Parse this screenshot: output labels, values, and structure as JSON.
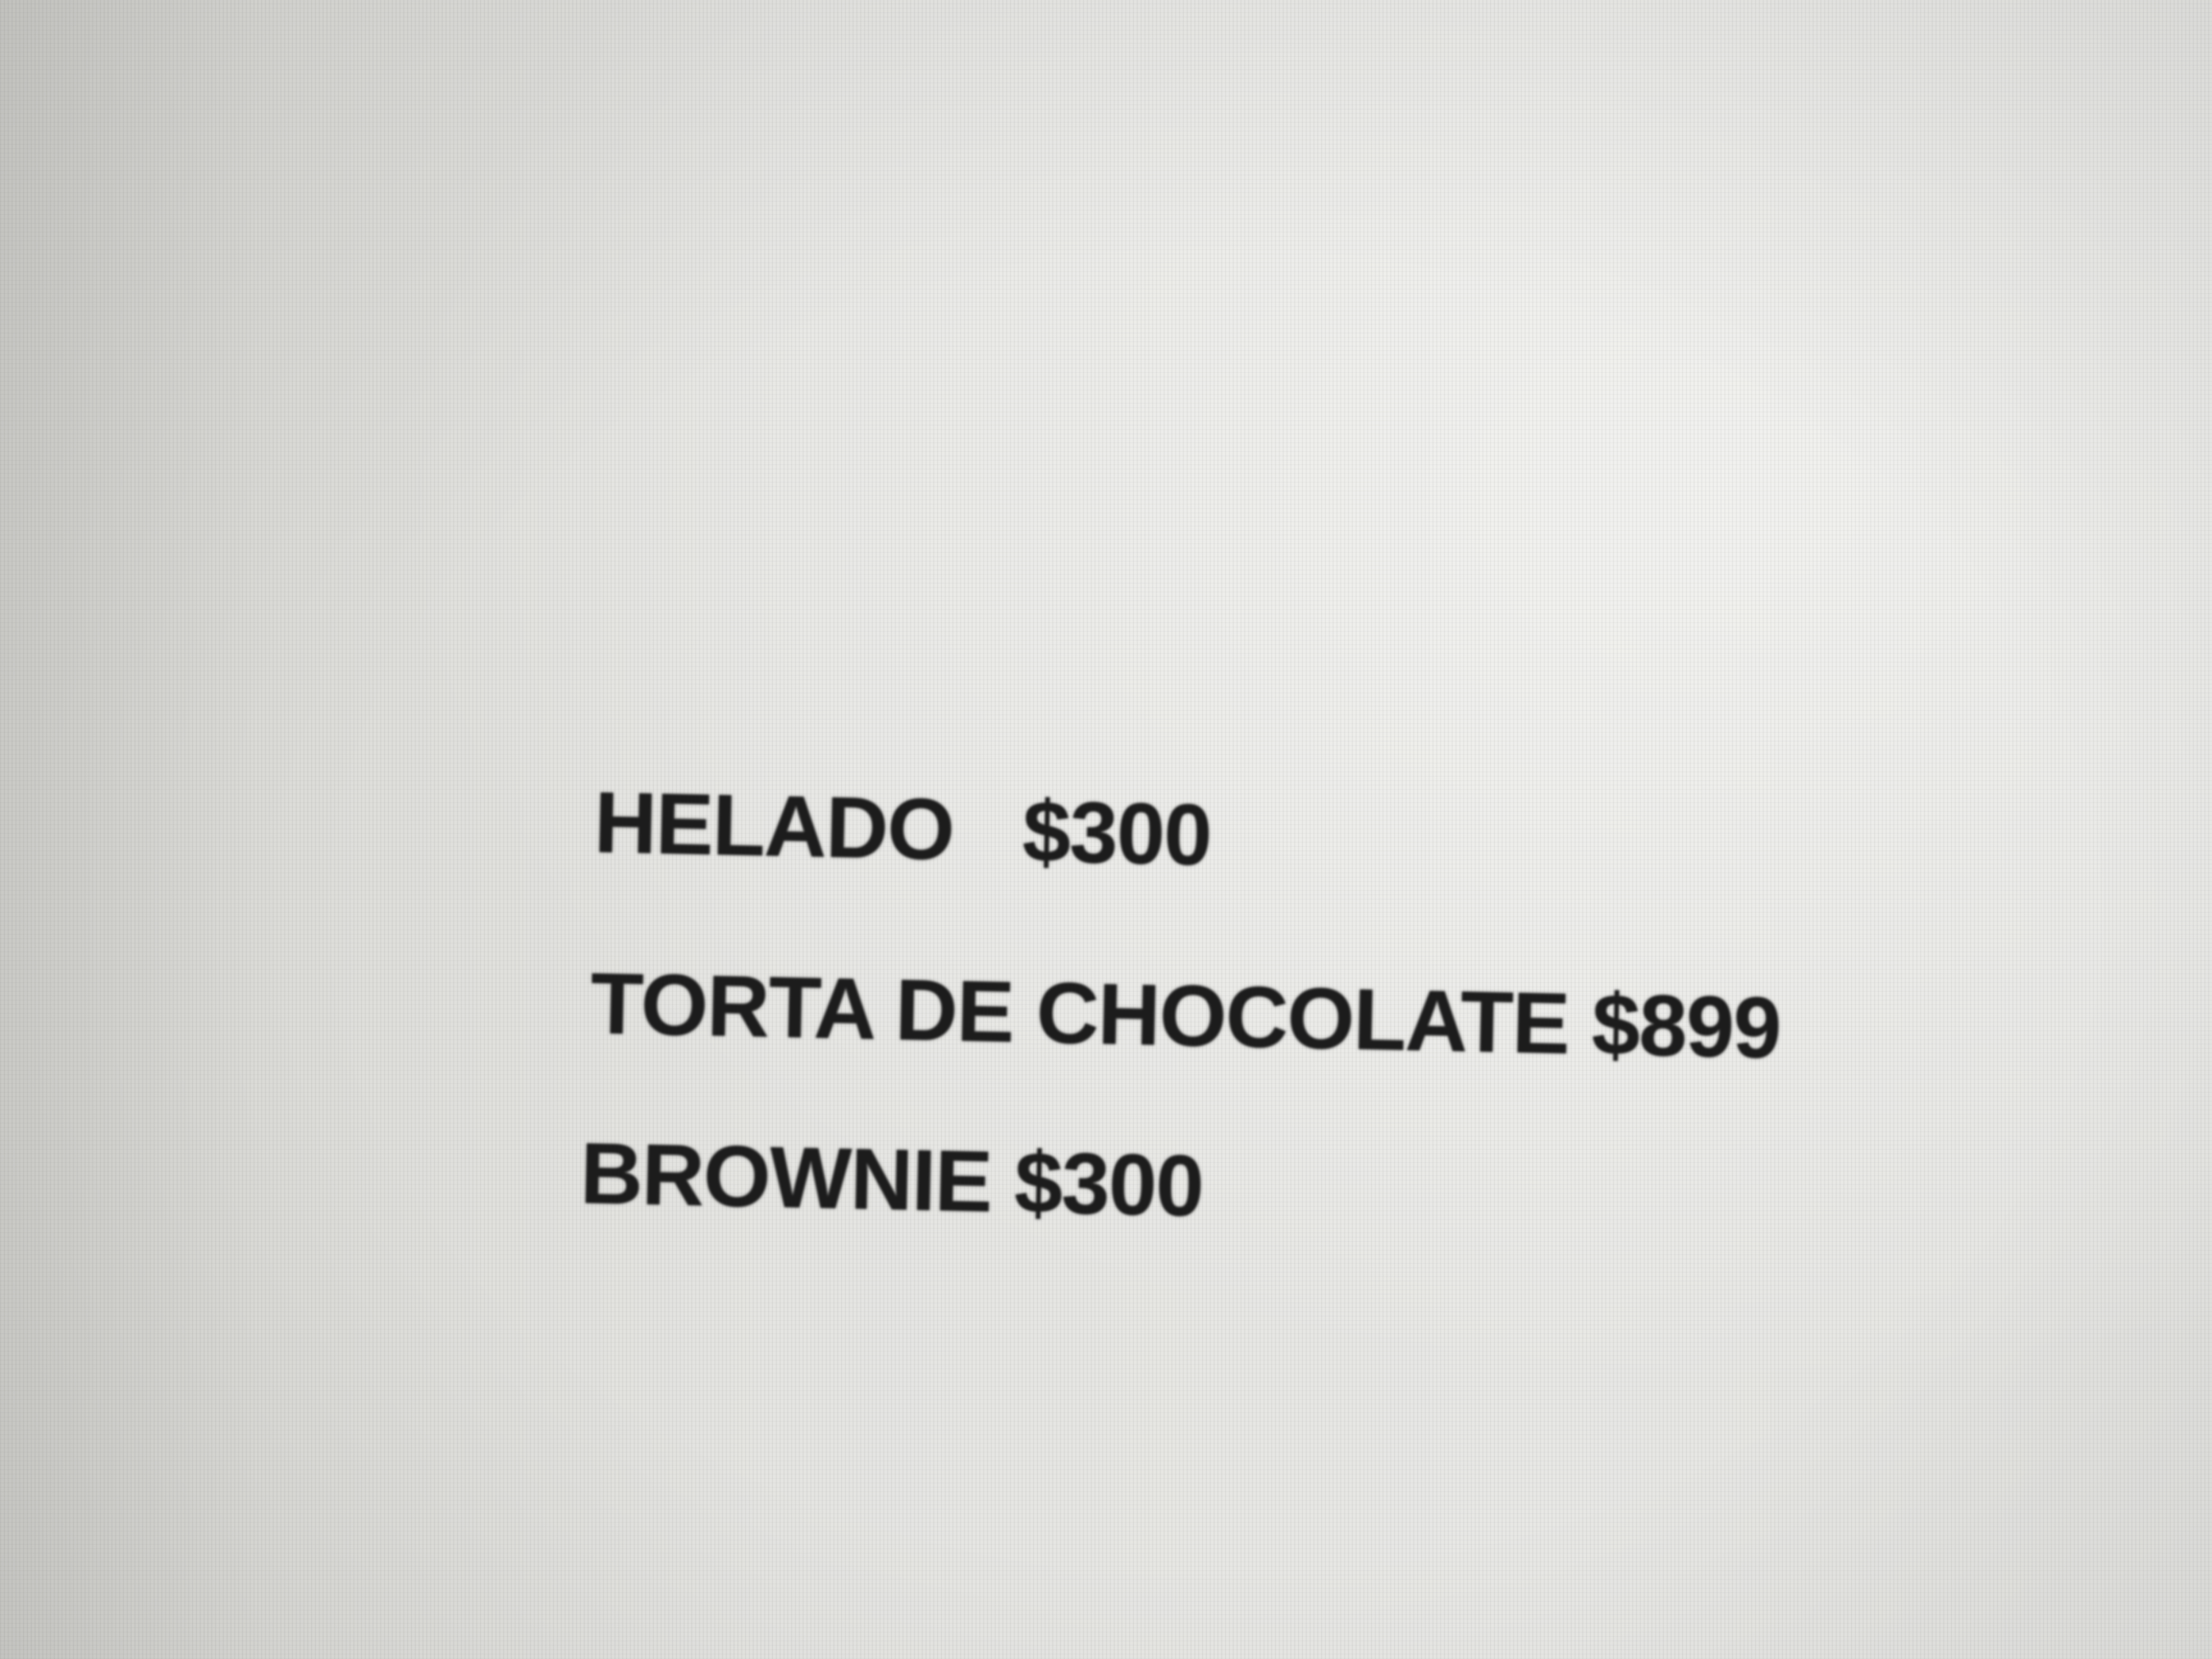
{
  "menu": {
    "items": [
      {
        "text": "HELADO   $300"
      },
      {
        "text": "TORTA DE CHOCOLATE $899"
      },
      {
        "text": "BROWNIE $300"
      }
    ]
  },
  "colors": {
    "background": "#e4e4e1",
    "text": "#1c1c1c"
  }
}
